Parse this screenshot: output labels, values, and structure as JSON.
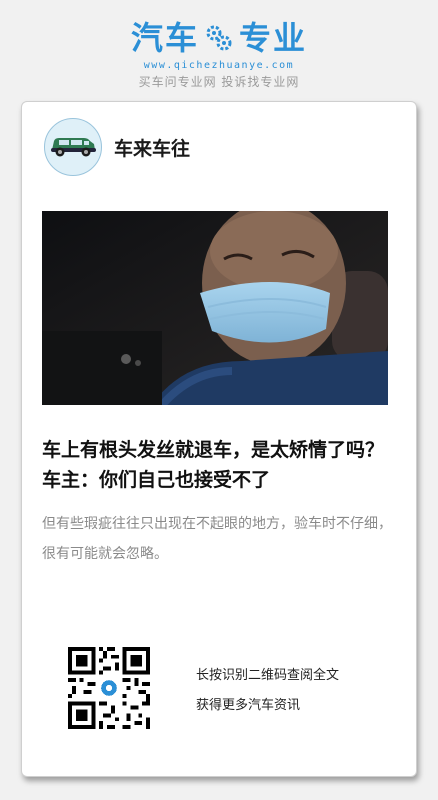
{
  "brand": {
    "word_left": "汽车",
    "word_right": "专业",
    "url": "www.qichezhuanye.com",
    "slogan": "买车问专业网 投诉找专业网",
    "color": "#2b8fd6"
  },
  "card": {
    "author_name": "车来车往",
    "avatar_icon": "green-car-icon",
    "photo_icon": "masked-man-photo",
    "headline": "车上有根头发丝就退车，是太矫情了吗？车主：你们自己也接受不了",
    "summary": "但有些瑕疵往往只出现在不起眼的地方，验车时不仔细，很有可能就会忽略。",
    "qr_line1": "长按识别二维码查阅全文",
    "qr_line2": "获得更多汽车资讯"
  }
}
